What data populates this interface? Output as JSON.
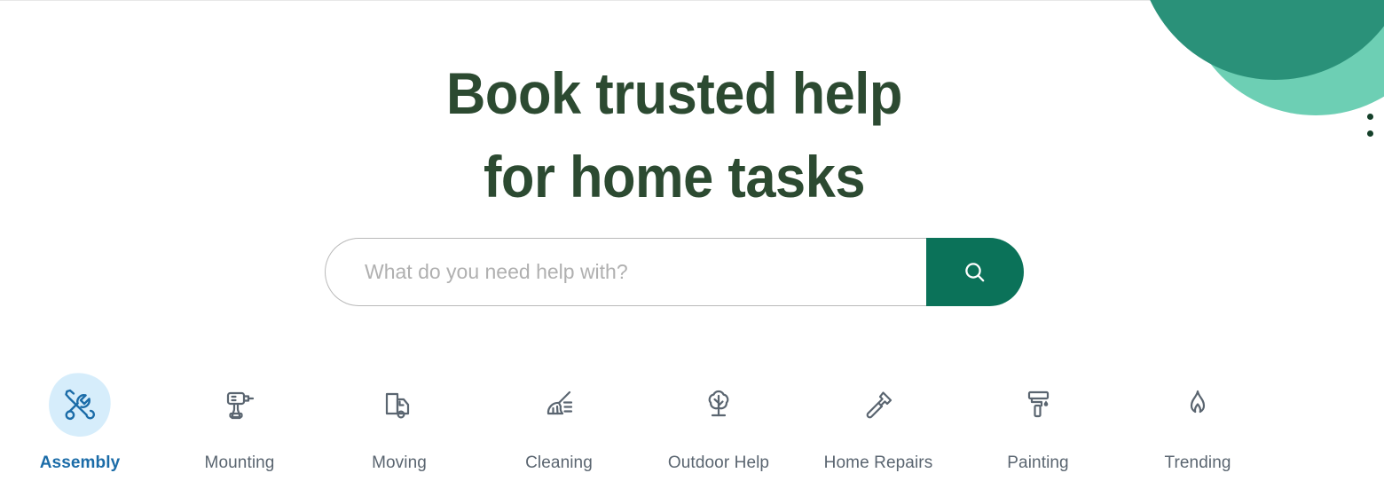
{
  "hero": {
    "headline_line1": "Book trusted help",
    "headline_line2": "for home tasks"
  },
  "search": {
    "placeholder": "What do you need help with?",
    "value": "",
    "button_icon": "search-icon"
  },
  "menu": {
    "icon": "more-vertical-icon"
  },
  "decor": {
    "blob_teal_color": "#2A9179",
    "blob_mint_color": "#6DCFB4"
  },
  "colors": {
    "headline_green": "#2C4A31",
    "search_button_green": "#0B7259",
    "active_blue": "#1B6CA8",
    "active_blob_blue": "#D6EDFB",
    "inactive_gray": "#5A6570"
  },
  "categories": [
    {
      "label": "Assembly",
      "icon": "wrench-screwdriver-icon",
      "active": true
    },
    {
      "label": "Mounting",
      "icon": "drill-icon",
      "active": false
    },
    {
      "label": "Moving",
      "icon": "truck-icon",
      "active": false
    },
    {
      "label": "Cleaning",
      "icon": "broom-icon",
      "active": false
    },
    {
      "label": "Outdoor Help",
      "icon": "tree-icon",
      "active": false
    },
    {
      "label": "Home Repairs",
      "icon": "hammer-icon",
      "active": false
    },
    {
      "label": "Painting",
      "icon": "paint-roller-icon",
      "active": false
    },
    {
      "label": "Trending",
      "icon": "flame-icon",
      "active": false
    }
  ]
}
